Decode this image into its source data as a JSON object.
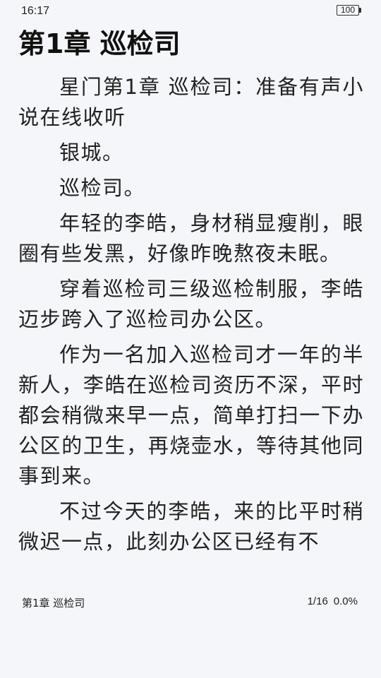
{
  "status_bar": {
    "time": "16:17",
    "battery": "100"
  },
  "chapter": {
    "title": "第1章 巡检司"
  },
  "paragraphs": [
    "星门第1章 巡检司：准备有声小说在线收听",
    "银城。",
    "巡检司。",
    "年轻的李皓，身材稍显瘦削，眼圈有些发黑，好像昨晚熬夜未眠。",
    "穿着巡检司三级巡检制服，李皓迈步跨入了巡检司办公区。",
    "作为一名加入巡检司才一年的半新人，李皓在巡检司资历不深，平时都会稍微来早一点，简单打扫一下办公区的卫生，再烧壶水，等待其他同事到来。",
    "不过今天的李皓，来的比平时稍微迟一点，此刻办公区已经有不"
  ],
  "footer": {
    "chapter_title": "第1章 巡检司",
    "page": "1/16",
    "percent": "0.0%"
  }
}
